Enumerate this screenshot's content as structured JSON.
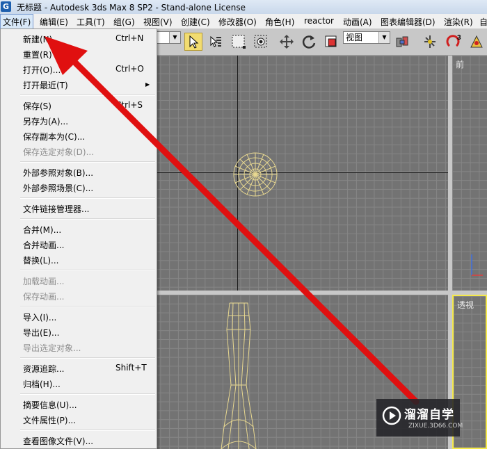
{
  "window": {
    "title": "无标题 - Autodesk 3ds Max 8 SP2  - Stand-alone License",
    "icon_glyph": "G"
  },
  "menubar": {
    "items": [
      {
        "label": "文件(F)"
      },
      {
        "label": "编辑(E)"
      },
      {
        "label": "工具(T)"
      },
      {
        "label": "组(G)"
      },
      {
        "label": "视图(V)"
      },
      {
        "label": "创建(C)"
      },
      {
        "label": "修改器(O)"
      },
      {
        "label": "角色(H)"
      },
      {
        "label": "reactor"
      },
      {
        "label": "动画(A)"
      },
      {
        "label": "图表编辑器(D)"
      },
      {
        "label": "渲染(R)"
      },
      {
        "label": "自"
      }
    ]
  },
  "toolbar": {
    "view_dropdown_value": "视图",
    "icons": [
      "select-object-icon",
      "select-by-name-icon",
      "rectangular-selection-icon",
      "window-crossing-icon",
      "select-and-move-icon",
      "select-and-rotate-icon",
      "select-and-scale-icon",
      "select-and-manipulate-icon",
      "angle-snap-icon",
      "percent-snap-icon"
    ],
    "snap_number": "3",
    "colors": {
      "selected_bg": "#f2dc70"
    }
  },
  "file_menu": {
    "groups": [
      [
        {
          "label": "新建(N)...",
          "shortcut": "Ctrl+N",
          "enabled": true
        },
        {
          "label": "重置(R)",
          "shortcut": "",
          "enabled": true
        },
        {
          "label": "打开(O)...",
          "shortcut": "Ctrl+O",
          "enabled": true
        },
        {
          "label": "打开最近(T)",
          "shortcut": "",
          "enabled": true,
          "submenu": true
        }
      ],
      [
        {
          "label": "保存(S)",
          "shortcut": "Ctrl+S",
          "enabled": true
        },
        {
          "label": "另存为(A)...",
          "shortcut": "",
          "enabled": true
        },
        {
          "label": "保存副本为(C)...",
          "shortcut": "",
          "enabled": true
        },
        {
          "label": "保存选定对象(D)...",
          "shortcut": "",
          "enabled": false
        }
      ],
      [
        {
          "label": "外部参照对象(B)...",
          "shortcut": "",
          "enabled": true
        },
        {
          "label": "外部参照场景(C)...",
          "shortcut": "",
          "enabled": true
        }
      ],
      [
        {
          "label": "文件链接管理器...",
          "shortcut": "",
          "enabled": true
        }
      ],
      [
        {
          "label": "合并(M)...",
          "shortcut": "",
          "enabled": true
        },
        {
          "label": "合并动画...",
          "shortcut": "",
          "enabled": true
        },
        {
          "label": "替换(L)...",
          "shortcut": "",
          "enabled": true
        }
      ],
      [
        {
          "label": "加载动画...",
          "shortcut": "",
          "enabled": false
        },
        {
          "label": "保存动画...",
          "shortcut": "",
          "enabled": false
        }
      ],
      [
        {
          "label": "导入(I)...",
          "shortcut": "",
          "enabled": true
        },
        {
          "label": "导出(E)...",
          "shortcut": "",
          "enabled": true
        },
        {
          "label": "导出选定对象...",
          "shortcut": "",
          "enabled": false
        }
      ],
      [
        {
          "label": "资源追踪...",
          "shortcut": "Shift+T",
          "enabled": true
        },
        {
          "label": "归档(H)...",
          "shortcut": "",
          "enabled": true
        }
      ],
      [
        {
          "label": "摘要信息(U)...",
          "shortcut": "",
          "enabled": true
        },
        {
          "label": "文件属性(P)...",
          "shortcut": "",
          "enabled": true
        }
      ],
      [
        {
          "label": "查看图像文件(V)...",
          "shortcut": "",
          "enabled": true
        }
      ]
    ]
  },
  "viewports": {
    "front_label": "前",
    "perspective_label": "透视",
    "colors": {
      "wireframe": "#e8d890",
      "active_border": "#f5e94a",
      "grid_bg": "#737373"
    }
  },
  "watermark": {
    "title": "溜溜自学",
    "url": "ZIXUE.3D66.COM"
  },
  "annotation": {
    "arrow_color": "#e01010"
  }
}
